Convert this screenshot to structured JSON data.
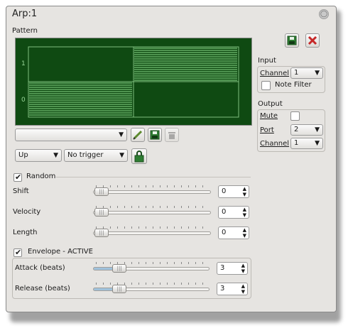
{
  "window": {
    "title": "Arp:1"
  },
  "pattern": {
    "section_label": "Pattern",
    "y_axis_labels": [
      "1",
      "0"
    ],
    "steps": [
      0,
      1
    ],
    "preset_value": "",
    "direction": "Up",
    "trigger": "No trigger"
  },
  "input": {
    "section_label": "Input",
    "channel_label": "Channel",
    "channel_value": "1",
    "note_filter_label": "Note Filter",
    "note_filter_checked": false
  },
  "output": {
    "section_label": "Output",
    "mute_label": "Mute",
    "mute_checked": false,
    "port_label": "Port",
    "port_value": "2",
    "channel_label": "Channel",
    "channel_value": "1"
  },
  "random": {
    "label": "Random",
    "checked": true,
    "shift": {
      "label": "Shift",
      "value": "0",
      "level": 0
    },
    "velocity": {
      "label": "Velocity",
      "value": "0",
      "level": 0
    },
    "length": {
      "label": "Length",
      "value": "0",
      "level": 0
    }
  },
  "envelope": {
    "label": "Envelope - ACTIVE",
    "checked": true,
    "attack": {
      "label": "Attack (beats)",
      "value": "3",
      "level": 0.18
    },
    "release": {
      "label": "Release (beats)",
      "value": "3",
      "level": 0.18
    }
  },
  "colors": {
    "display_bg": "#0f4a12",
    "display_line": "#8fdf8f",
    "slider_fill": "#9fc2dc"
  },
  "icons": {
    "title_close": "close-icon",
    "save_pattern": "save-icon",
    "remove_pattern": "delete-icon",
    "rename_preset": "pencil-icon",
    "save_preset": "save-icon",
    "remove_preset": "delete-icon",
    "lock": "lock-icon"
  }
}
